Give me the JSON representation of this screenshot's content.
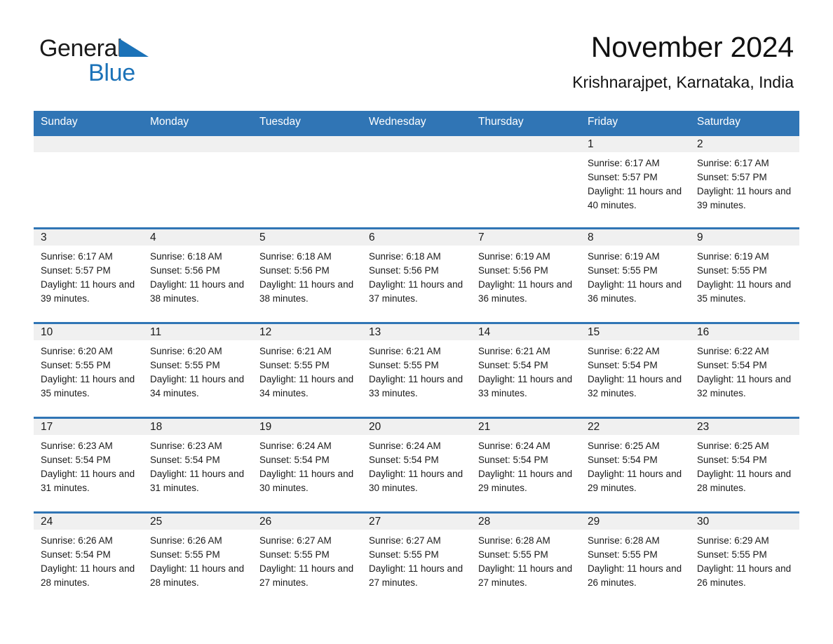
{
  "brand": {
    "name_part1": "General",
    "name_part2": "Blue",
    "logo_icon": "triangle-icon",
    "accent_color": "#1b72b8"
  },
  "header": {
    "title": "November 2024",
    "location": "Krishnarajpet, Karnataka, India"
  },
  "calendar": {
    "header_color": "#3075b5",
    "daynum_band_color": "#f0f0f0",
    "weekday_headers": [
      "Sunday",
      "Monday",
      "Tuesday",
      "Wednesday",
      "Thursday",
      "Friday",
      "Saturday"
    ],
    "labels": {
      "sunrise_prefix": "Sunrise:",
      "sunset_prefix": "Sunset:",
      "daylight_prefix": "Daylight:"
    },
    "weeks": [
      [
        {
          "day": "",
          "empty": true
        },
        {
          "day": "",
          "empty": true
        },
        {
          "day": "",
          "empty": true
        },
        {
          "day": "",
          "empty": true
        },
        {
          "day": "",
          "empty": true
        },
        {
          "day": "1",
          "sunrise": "Sunrise: 6:17 AM",
          "sunset": "Sunset: 5:57 PM",
          "daylight": "Daylight: 11 hours and 40 minutes."
        },
        {
          "day": "2",
          "sunrise": "Sunrise: 6:17 AM",
          "sunset": "Sunset: 5:57 PM",
          "daylight": "Daylight: 11 hours and 39 minutes."
        }
      ],
      [
        {
          "day": "3",
          "sunrise": "Sunrise: 6:17 AM",
          "sunset": "Sunset: 5:57 PM",
          "daylight": "Daylight: 11 hours and 39 minutes."
        },
        {
          "day": "4",
          "sunrise": "Sunrise: 6:18 AM",
          "sunset": "Sunset: 5:56 PM",
          "daylight": "Daylight: 11 hours and 38 minutes."
        },
        {
          "day": "5",
          "sunrise": "Sunrise: 6:18 AM",
          "sunset": "Sunset: 5:56 PM",
          "daylight": "Daylight: 11 hours and 38 minutes."
        },
        {
          "day": "6",
          "sunrise": "Sunrise: 6:18 AM",
          "sunset": "Sunset: 5:56 PM",
          "daylight": "Daylight: 11 hours and 37 minutes."
        },
        {
          "day": "7",
          "sunrise": "Sunrise: 6:19 AM",
          "sunset": "Sunset: 5:56 PM",
          "daylight": "Daylight: 11 hours and 36 minutes."
        },
        {
          "day": "8",
          "sunrise": "Sunrise: 6:19 AM",
          "sunset": "Sunset: 5:55 PM",
          "daylight": "Daylight: 11 hours and 36 minutes."
        },
        {
          "day": "9",
          "sunrise": "Sunrise: 6:19 AM",
          "sunset": "Sunset: 5:55 PM",
          "daylight": "Daylight: 11 hours and 35 minutes."
        }
      ],
      [
        {
          "day": "10",
          "sunrise": "Sunrise: 6:20 AM",
          "sunset": "Sunset: 5:55 PM",
          "daylight": "Daylight: 11 hours and 35 minutes."
        },
        {
          "day": "11",
          "sunrise": "Sunrise: 6:20 AM",
          "sunset": "Sunset: 5:55 PM",
          "daylight": "Daylight: 11 hours and 34 minutes."
        },
        {
          "day": "12",
          "sunrise": "Sunrise: 6:21 AM",
          "sunset": "Sunset: 5:55 PM",
          "daylight": "Daylight: 11 hours and 34 minutes."
        },
        {
          "day": "13",
          "sunrise": "Sunrise: 6:21 AM",
          "sunset": "Sunset: 5:55 PM",
          "daylight": "Daylight: 11 hours and 33 minutes."
        },
        {
          "day": "14",
          "sunrise": "Sunrise: 6:21 AM",
          "sunset": "Sunset: 5:54 PM",
          "daylight": "Daylight: 11 hours and 33 minutes."
        },
        {
          "day": "15",
          "sunrise": "Sunrise: 6:22 AM",
          "sunset": "Sunset: 5:54 PM",
          "daylight": "Daylight: 11 hours and 32 minutes."
        },
        {
          "day": "16",
          "sunrise": "Sunrise: 6:22 AM",
          "sunset": "Sunset: 5:54 PM",
          "daylight": "Daylight: 11 hours and 32 minutes."
        }
      ],
      [
        {
          "day": "17",
          "sunrise": "Sunrise: 6:23 AM",
          "sunset": "Sunset: 5:54 PM",
          "daylight": "Daylight: 11 hours and 31 minutes."
        },
        {
          "day": "18",
          "sunrise": "Sunrise: 6:23 AM",
          "sunset": "Sunset: 5:54 PM",
          "daylight": "Daylight: 11 hours and 31 minutes."
        },
        {
          "day": "19",
          "sunrise": "Sunrise: 6:24 AM",
          "sunset": "Sunset: 5:54 PM",
          "daylight": "Daylight: 11 hours and 30 minutes."
        },
        {
          "day": "20",
          "sunrise": "Sunrise: 6:24 AM",
          "sunset": "Sunset: 5:54 PM",
          "daylight": "Daylight: 11 hours and 30 minutes."
        },
        {
          "day": "21",
          "sunrise": "Sunrise: 6:24 AM",
          "sunset": "Sunset: 5:54 PM",
          "daylight": "Daylight: 11 hours and 29 minutes."
        },
        {
          "day": "22",
          "sunrise": "Sunrise: 6:25 AM",
          "sunset": "Sunset: 5:54 PM",
          "daylight": "Daylight: 11 hours and 29 minutes."
        },
        {
          "day": "23",
          "sunrise": "Sunrise: 6:25 AM",
          "sunset": "Sunset: 5:54 PM",
          "daylight": "Daylight: 11 hours and 28 minutes."
        }
      ],
      [
        {
          "day": "24",
          "sunrise": "Sunrise: 6:26 AM",
          "sunset": "Sunset: 5:54 PM",
          "daylight": "Daylight: 11 hours and 28 minutes."
        },
        {
          "day": "25",
          "sunrise": "Sunrise: 6:26 AM",
          "sunset": "Sunset: 5:55 PM",
          "daylight": "Daylight: 11 hours and 28 minutes."
        },
        {
          "day": "26",
          "sunrise": "Sunrise: 6:27 AM",
          "sunset": "Sunset: 5:55 PM",
          "daylight": "Daylight: 11 hours and 27 minutes."
        },
        {
          "day": "27",
          "sunrise": "Sunrise: 6:27 AM",
          "sunset": "Sunset: 5:55 PM",
          "daylight": "Daylight: 11 hours and 27 minutes."
        },
        {
          "day": "28",
          "sunrise": "Sunrise: 6:28 AM",
          "sunset": "Sunset: 5:55 PM",
          "daylight": "Daylight: 11 hours and 27 minutes."
        },
        {
          "day": "29",
          "sunrise": "Sunrise: 6:28 AM",
          "sunset": "Sunset: 5:55 PM",
          "daylight": "Daylight: 11 hours and 26 minutes."
        },
        {
          "day": "30",
          "sunrise": "Sunrise: 6:29 AM",
          "sunset": "Sunset: 5:55 PM",
          "daylight": "Daylight: 11 hours and 26 minutes."
        }
      ]
    ]
  }
}
